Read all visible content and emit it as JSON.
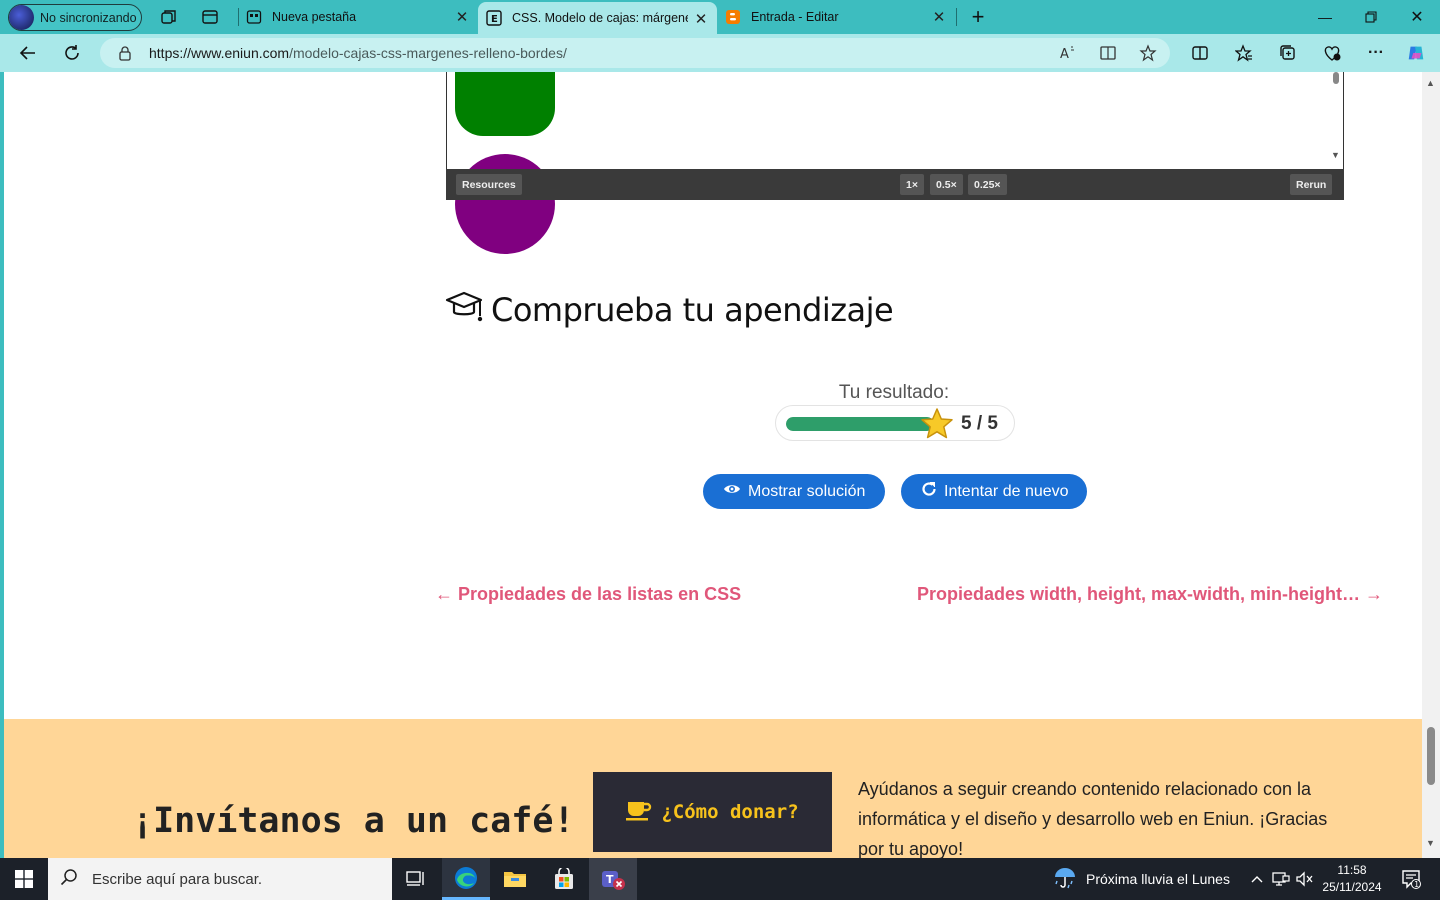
{
  "browser": {
    "profile_label": "No sincronizando",
    "tabs": [
      {
        "label": "Nueva pestaña"
      },
      {
        "label": "CSS. Modelo de cajas: márgenes,"
      },
      {
        "label": "Entrada - Editar"
      }
    ],
    "url_host": "https://www.eniun.com",
    "url_path": "/modelo-cajas-css-margenes-relleno-bordes/"
  },
  "demo_toolbar": {
    "resources": "Resources",
    "zoom_1": "1×",
    "zoom_05": "0.5×",
    "zoom_025": "0.25×",
    "rerun": "Rerun"
  },
  "quiz": {
    "title": "Comprueba tu apendizaje",
    "result_label": "Tu resultado:",
    "score": "5 / 5",
    "score_fraction": 1.0,
    "show_solution": "Mostrar solución",
    "try_again": "Intentar de nuevo"
  },
  "post_nav": {
    "prev": "← Propiedades de las listas en CSS",
    "next": "Propiedades width, height, max-width, min-height… →"
  },
  "donate": {
    "title": "¡Invítanos a un café!",
    "button": "¿Cómo donar?",
    "text": "Ayúdanos a seguir creando contenido relacionado con la informática y el diseño y desarrollo web en Eniun. ¡Gracias por tu apoyo!"
  },
  "taskbar": {
    "search_placeholder": "Escribe aquí para buscar.",
    "weather": "Próxima lluvia el Lunes",
    "time": "11:58",
    "date": "25/11/2024",
    "notifications": "1"
  },
  "colors": {
    "browser_chrome": "#3dbdbf",
    "accent_blue": "#1a6fd4",
    "link_pink": "#e0577a",
    "donate_band": "#ffd697",
    "progress_green": "#2e9e6a"
  }
}
